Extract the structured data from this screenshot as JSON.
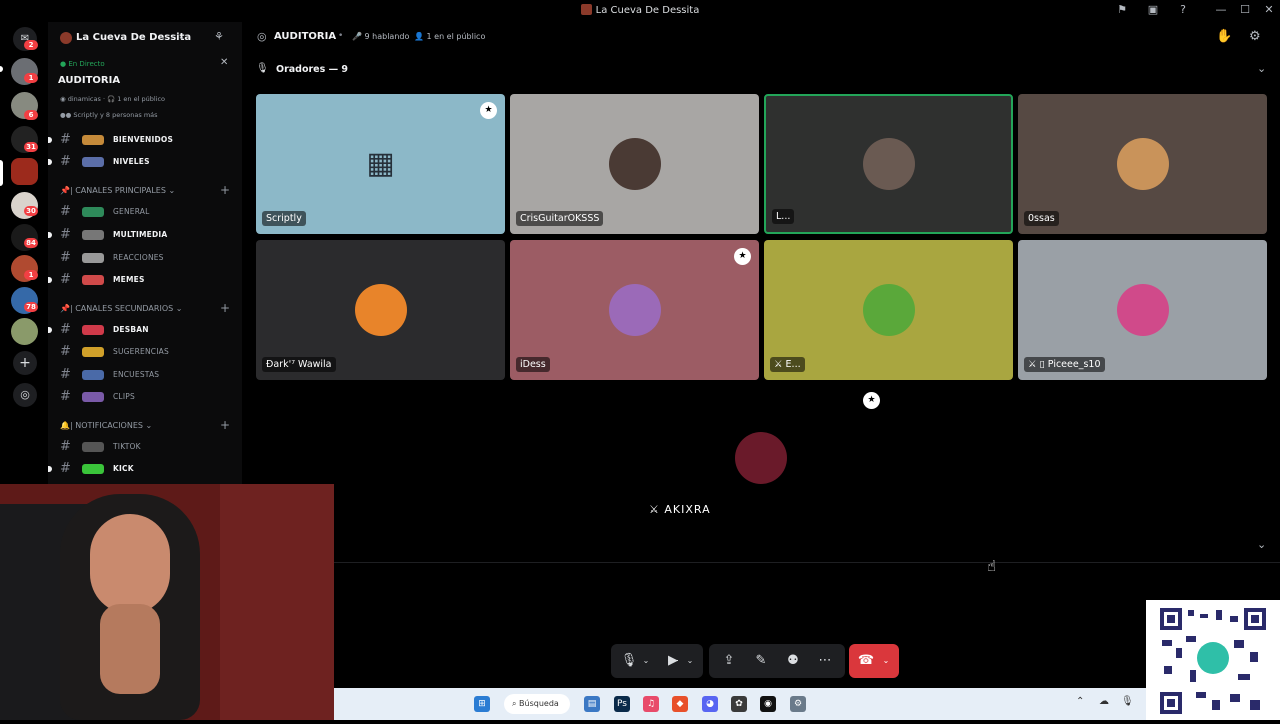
{
  "window": {
    "title": "La Cueva De Dessita"
  },
  "guilds": {
    "badges": [
      "2",
      "1",
      "6",
      "31",
      "30",
      "84",
      "1",
      "78"
    ]
  },
  "server": {
    "name": "La Cueva De Dessita"
  },
  "stage_live": {
    "label": "En Directo",
    "name": "AUDITORIA",
    "line1_tag": "dinamicas",
    "line1_audience": "1 en el público",
    "line2": "Scriptly y 8 personas más"
  },
  "channels": {
    "top": [
      {
        "name": "BIENVENIDOS"
      },
      {
        "name": "NIVELES"
      }
    ],
    "cat_main": "| CANALES PRINCIPALES",
    "main": [
      {
        "name": "GENERAL"
      },
      {
        "name": "MULTIMEDIA"
      },
      {
        "name": "REACCIONES"
      },
      {
        "name": "MEMES"
      }
    ],
    "cat_secondary": "| CANALES SECUNDARIOS",
    "secondary": [
      {
        "name": "DESBAN"
      },
      {
        "name": "SUGERENCIAS"
      },
      {
        "name": "ENCUESTAS"
      },
      {
        "name": "CLIPS"
      }
    ],
    "cat_notif": "| NOTIFICACIONES",
    "notif": [
      {
        "name": "TIKTOK"
      },
      {
        "name": "KICK"
      }
    ]
  },
  "stage_header": {
    "name": "AUDITORIA",
    "speaking": "9 hablando",
    "audience": "1 en el público"
  },
  "speakers_header": "Oradores — 9",
  "speakers": [
    {
      "name": "Scriptly",
      "bg": "#8cb8c8"
    },
    {
      "name": "CrisGuitarOKSSS",
      "bg": "#a8a6a4"
    },
    {
      "name": "L...",
      "bg": "#2f302f"
    },
    {
      "name": "0ssas",
      "bg": "#564943"
    },
    {
      "name": "Ɖark'⁷ Wawila",
      "bg": "#2b2b2d"
    },
    {
      "name": "iDess",
      "bg": "#9c5c64"
    },
    {
      "name": "E...",
      "bg": "#a9a640"
    },
    {
      "name": "Piceee_s10",
      "bg": "#9aa0a6"
    },
    {
      "name": "AKIXRA",
      "bg": "#000000"
    }
  ],
  "taskbar": {
    "search_label": "Búsqueda"
  },
  "colors": {
    "accent_green": "#23a559",
    "danger": "#da373c",
    "notify": "#f23f43"
  }
}
